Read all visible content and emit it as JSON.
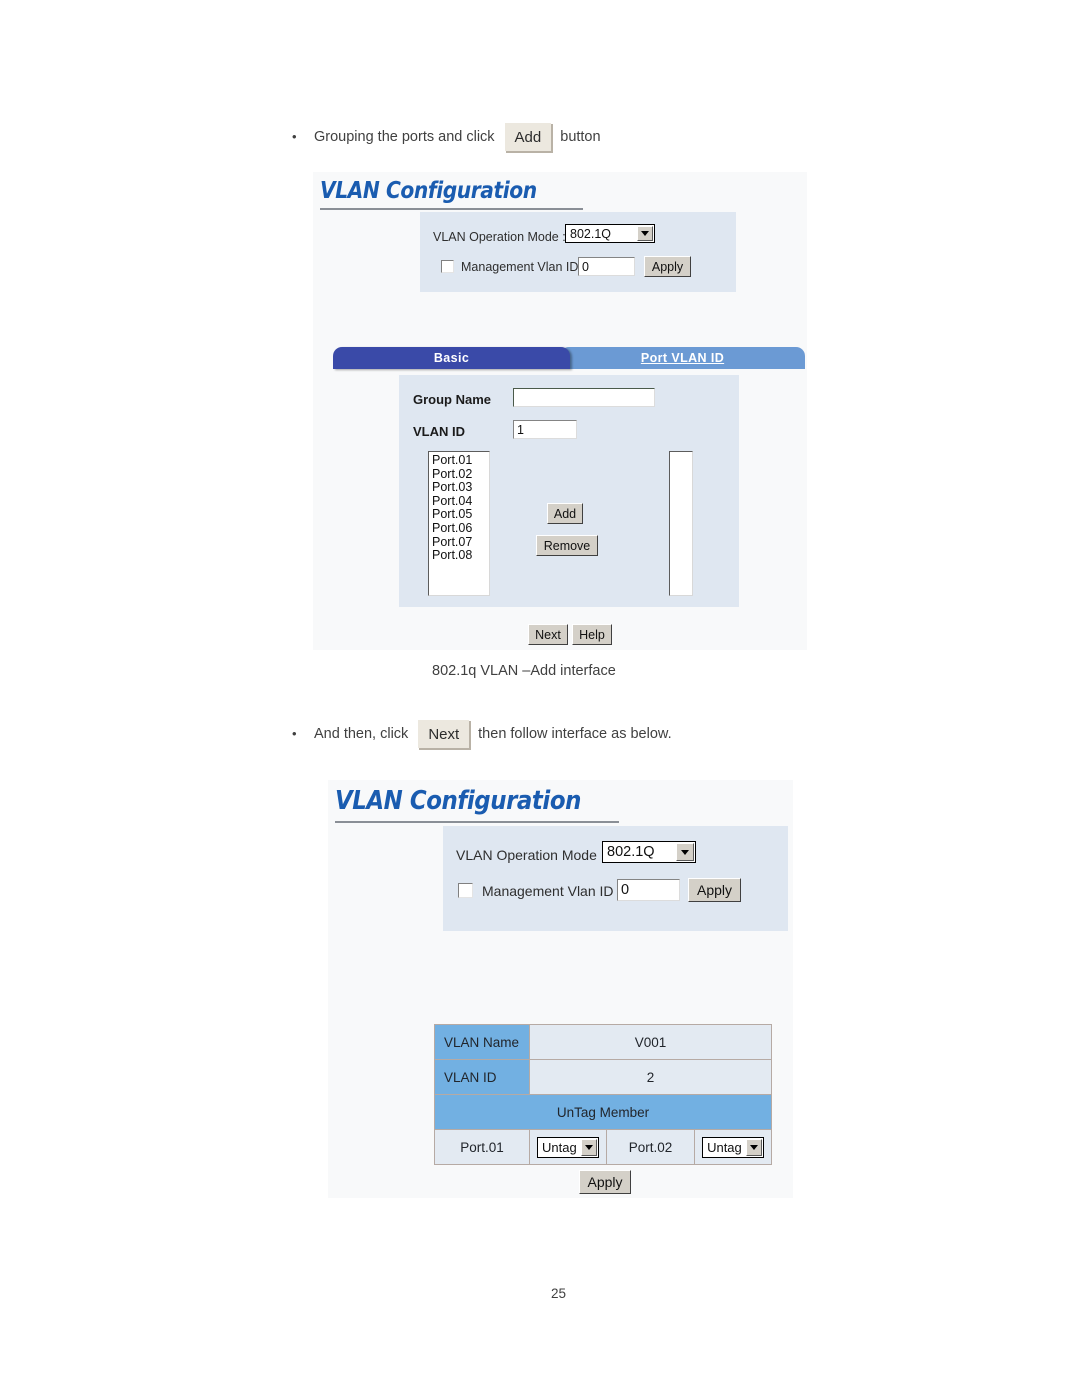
{
  "doc": {
    "page_number": "25",
    "figure_caption": "802.1q VLAN –Add interface"
  },
  "instructions": [
    {
      "bullet": "•",
      "text_before": "Grouping the ports and click",
      "button_label": "Add",
      "text_after": "button"
    },
    {
      "bullet": "•",
      "text_before": "And then, click",
      "button_label": "Next",
      "text_after": "then follow interface as below."
    }
  ],
  "panel_add": {
    "title": "VLAN Configuration",
    "operation_mode": {
      "label": "VLAN Operation Mode :",
      "value": "802.1Q"
    },
    "management_vlan": {
      "label": "Management Vlan ID :",
      "value": "0",
      "checked": false,
      "apply_label": "Apply"
    },
    "tabs": [
      {
        "label": "Basic",
        "active": true
      },
      {
        "label": "Port VLAN ID",
        "active": false
      }
    ],
    "group_name": {
      "label": "Group Name",
      "value": ""
    },
    "vlan_id": {
      "label": "VLAN ID",
      "value": "1"
    },
    "available_ports": [
      "Port.01",
      "Port.02",
      "Port.03",
      "Port.04",
      "Port.05",
      "Port.06",
      "Port.07",
      "Port.08"
    ],
    "selected_ports": [],
    "add_label": "Add",
    "remove_label": "Remove",
    "next_label": "Next",
    "help_label": "Help"
  },
  "panel_member": {
    "title": "VLAN Configuration",
    "operation_mode": {
      "label": "VLAN Operation Mode :",
      "value": "802.1Q"
    },
    "management_vlan": {
      "label": "Management Vlan ID :",
      "value": "0",
      "checked": false,
      "apply_label": "Apply"
    },
    "table": {
      "vlan_name_label": "VLAN Name",
      "vlan_name_value": "V001",
      "vlan_id_label": "VLAN ID",
      "vlan_id_value": "2",
      "untag_member_label": "UnTag Member",
      "members": [
        {
          "port": "Port.01",
          "tag": "Untag"
        },
        {
          "port": "Port.02",
          "tag": "Untag"
        }
      ]
    },
    "apply_label": "Apply"
  },
  "colors": {
    "title_blue": "#1a5cb0",
    "tab_active": "#3a4aa8",
    "tab_inactive": "#6b9ad4",
    "table_header": "#72b0e2",
    "form_box": "#dfe7f1",
    "panel_bg": "#f8f9fa"
  }
}
